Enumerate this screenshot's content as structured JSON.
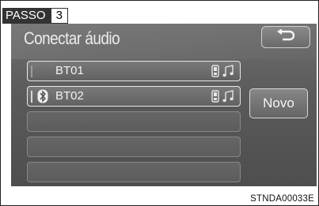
{
  "step": {
    "label": "PASSO",
    "number": "3"
  },
  "screen": {
    "title": "Conectar áudio",
    "back_icon": "return-arrow-icon",
    "devices": [
      {
        "name": "BT01",
        "connected": false,
        "icons": [
          "phone-icon",
          "music-note-icon"
        ]
      },
      {
        "name": "BT02",
        "connected": true,
        "icons": [
          "bluetooth-icon",
          "phone-icon",
          "music-note-icon"
        ]
      }
    ],
    "empty_slots": 3,
    "new_button_label": "Novo"
  },
  "figure_code": "STNDA00033E"
}
